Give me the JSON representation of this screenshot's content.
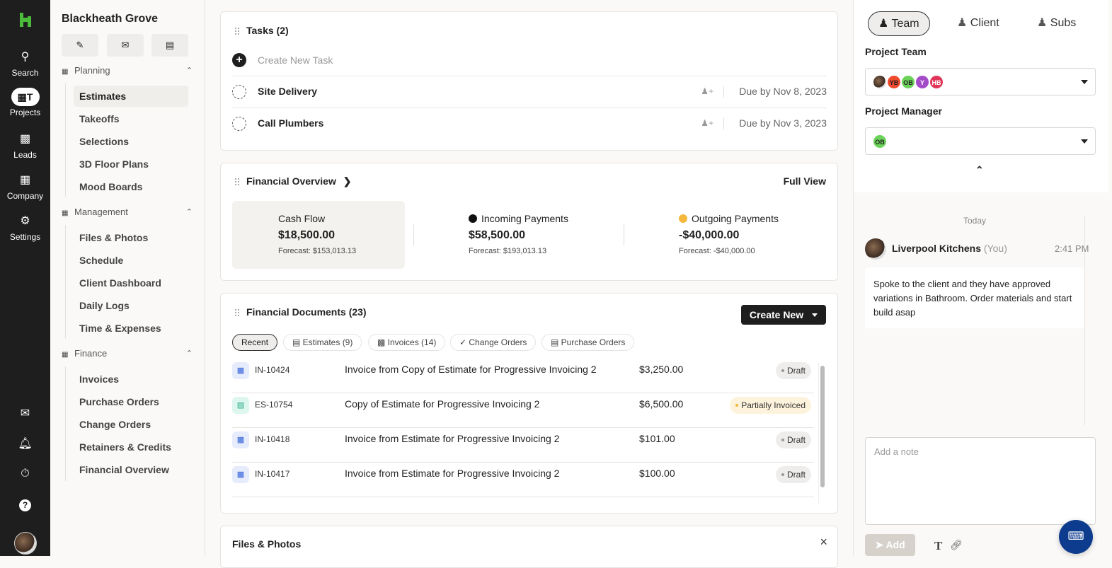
{
  "rail": {
    "items": [
      {
        "label": "Search",
        "icon": "search-icon"
      },
      {
        "label": "Projects",
        "icon": "projects-icon",
        "active": true
      },
      {
        "label": "Leads",
        "icon": "leads-icon"
      },
      {
        "label": "Company",
        "icon": "company-icon"
      },
      {
        "label": "Settings",
        "icon": "gear-icon"
      }
    ],
    "bottom_icons": [
      "inbox-icon",
      "bell-icon",
      "timer-icon",
      "help-icon"
    ]
  },
  "project": {
    "title": "Blackheath Grove",
    "quick_actions": [
      "edit-icon",
      "mail-icon",
      "notes-icon"
    ]
  },
  "sections": [
    {
      "title": "Planning",
      "items": [
        "Estimates",
        "Takeoffs",
        "Selections",
        "3D Floor Plans",
        "Mood Boards"
      ],
      "active": "Estimates"
    },
    {
      "title": "Management",
      "items": [
        "Files & Photos",
        "Schedule",
        "Client Dashboard",
        "Daily Logs",
        "Time & Expenses"
      ]
    },
    {
      "title": "Finance",
      "items": [
        "Invoices",
        "Purchase Orders",
        "Change Orders",
        "Retainers & Credits",
        "Financial Overview"
      ]
    }
  ],
  "tasks": {
    "title": "Tasks (2)",
    "create_placeholder": "Create New Task",
    "items": [
      {
        "name": "Site Delivery",
        "due": "Due by Nov 8, 2023"
      },
      {
        "name": "Call Plumbers",
        "due": "Due by Nov 3, 2023"
      }
    ]
  },
  "financial_overview": {
    "title": "Financial Overview",
    "full_view": "Full View",
    "cash_flow": {
      "label": "Cash Flow",
      "value": "$18,500.00",
      "forecast": "Forecast: $153,013.13"
    },
    "incoming": {
      "label": "Incoming Payments",
      "value": "$58,500.00",
      "forecast": "Forecast: $193,013.13",
      "color": "#111111"
    },
    "outgoing": {
      "label": "Outgoing Payments",
      "value": "-$40,000.00",
      "forecast": "Forecast: -$40,000.00",
      "color": "#f5b83d"
    }
  },
  "financial_documents": {
    "title": "Financial Documents (23)",
    "create_label": "Create New",
    "filters": [
      "Recent",
      "Estimates (9)",
      "Invoices (14)",
      "Change Orders",
      "Purchase Orders"
    ],
    "rows": [
      {
        "type": "invoice",
        "number": "IN-10424",
        "name": "Invoice from Copy of Estimate for Progressive Invoicing 2",
        "amount": "$3,250.00",
        "status": "Draft"
      },
      {
        "type": "estimate",
        "number": "ES-10754",
        "name": "Copy of Estimate for Progressive Invoicing 2",
        "amount": "$6,500.00",
        "status": "Partially Invoiced"
      },
      {
        "type": "invoice",
        "number": "IN-10418",
        "name": "Invoice from Estimate for Progressive Invoicing 2",
        "amount": "$101.00",
        "status": "Draft"
      },
      {
        "type": "invoice",
        "number": "IN-10417",
        "name": "Invoice from Estimate for Progressive Invoicing 2",
        "amount": "$100.00",
        "status": "Draft"
      }
    ]
  },
  "files_photos": {
    "title": "Files & Photos",
    "close": "×"
  },
  "right_panel": {
    "tabs": [
      "Team",
      "Client",
      "Subs"
    ],
    "active_tab": "Team",
    "project_team_label": "Project Team",
    "team_avatars": [
      {
        "initials": "",
        "color": "#7a5a45",
        "photo": true
      },
      {
        "initials": "YB",
        "color": "#f04a2d"
      },
      {
        "initials": "OB",
        "color": "#6cd35a"
      },
      {
        "initials": "Y",
        "color": "#a44bc8"
      },
      {
        "initials": "HB",
        "color": "#e0365a"
      }
    ],
    "project_manager_label": "Project Manager",
    "manager_avatar": {
      "initials": "OB",
      "color": "#6cd35a"
    },
    "feed": {
      "date": "Today",
      "author": "Liverpool Kitchens",
      "you": "(You)",
      "time": "2:41 PM",
      "message": "Spoke to the client and they have approved variations in Bathroom. Order materials and start build asap"
    },
    "note_placeholder": "Add a note",
    "add_label": "Add"
  }
}
